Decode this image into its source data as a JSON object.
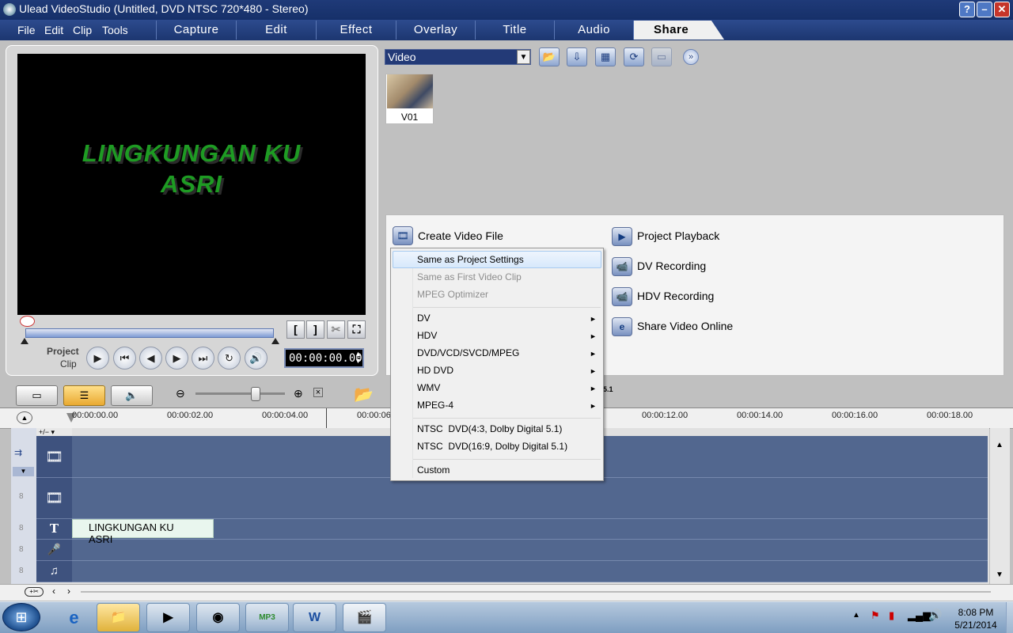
{
  "window": {
    "title": "Ulead VideoStudio (Untitled, DVD NTSC 720*480 - Stereo)",
    "help": "?",
    "minimize": "–",
    "maximize": "□",
    "close": "✕"
  },
  "menu": {
    "file": "File",
    "edit": "Edit",
    "clip": "Clip",
    "tools": "Tools"
  },
  "steps": {
    "capture": "Capture",
    "edit": "Edit",
    "effect": "Effect",
    "overlay": "Overlay",
    "title": "Title",
    "audio": "Audio",
    "share": "Share"
  },
  "preview": {
    "title_line1": "LINGKUNGAN KU",
    "title_line2": "ASRI",
    "mode_project": "Project",
    "mode_clip": "Clip",
    "timecode": "00:00:00.00",
    "mark_in": "[",
    "mark_out": "]"
  },
  "library": {
    "category": "Video",
    "thumb_label": "V01"
  },
  "share": {
    "create_video_file": "Create Video File",
    "project_playback": "Project Playback",
    "dv_recording": "DV Recording",
    "hdv_recording": "HDV Recording",
    "share_video_online": "Share Video Online"
  },
  "dropdown": {
    "items": [
      "Same as Project Settings",
      "Same as First Video Clip",
      "MPEG Optimizer",
      "DV",
      "HDV",
      "DVD/VCD/SVCD/MPEG",
      "HD DVD",
      "WMV",
      "MPEG-4",
      "NTSC  DVD(4:3, Dolby Digital 5.1)",
      "NTSC  DVD(16:9, Dolby Digital 5.1)",
      "Custom"
    ],
    "submenu_arrow": "►"
  },
  "ruler": {
    "ticks": [
      "00:00:00.00",
      "00:00:02.00",
      "00:00:04.00",
      "00:00:06",
      "00:00:12.00",
      "00:00:14.00",
      "00:00:16.00",
      "00:00:18.00"
    ]
  },
  "timeline": {
    "title_clip": "LINGKUNGAN KU ASRI",
    "add_remove": "+/− ▾",
    "track_video": "🎞",
    "track_overlay": "🎞",
    "track_title": "T",
    "track_voice": "🎤",
    "track_music": "♫"
  },
  "taskbar": {
    "time": "8:08 PM",
    "date": "5/21/2014"
  },
  "colors": {
    "title_green": "#1e9b23",
    "nav_blue": "#1c3670",
    "track_blue": "#52678f"
  }
}
